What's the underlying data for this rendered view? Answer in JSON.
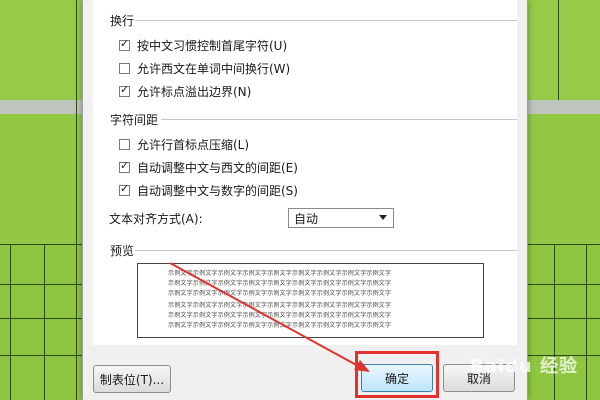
{
  "line_break": {
    "title": "换行",
    "options": [
      {
        "label": "按中文习惯控制首尾字符(U)",
        "checked": true
      },
      {
        "label": "允许西文在单词中间换行(W)",
        "checked": false
      },
      {
        "label": "允许标点溢出边界(N)",
        "checked": true
      }
    ]
  },
  "char_spacing": {
    "title": "字符间距",
    "options": [
      {
        "label": "允许行首标点压缩(L)",
        "checked": false
      },
      {
        "label": "自动调整中文与西文的间距(E)",
        "checked": true
      },
      {
        "label": "自动调整中文与数字的间距(S)",
        "checked": true
      }
    ],
    "align_label": "文本对齐方式(A):",
    "align_value": "自动"
  },
  "preview": {
    "title": "预览",
    "lines": [
      "示例文字示例文字示例文字示例文字示例文字示例文字示例文字示例文字示例文字",
      "示例文字示例文字示例文字示例文字示例文字示例文字示例文字示例文字示例文字",
      "示例文字示例文字示例文字示例文字示例文字示例文字示例文字示例文字示例文字",
      "示例文字示例文字示例文字示例文字示例文字示例文字示例文字示例文字示例文字",
      "示例文字示例文字示例文字示例文字示例文字示例文字示例文字示例文字示例文字",
      "示例文字示例文字示例文字示例文字示例文字示例文字示例文字示例文字示例文字"
    ]
  },
  "buttons": {
    "tabs": "制表位(T)...",
    "ok": "确定",
    "cancel": "取消"
  },
  "watermark": "Baidu 经验",
  "colors": {
    "highlight": "#e0332f",
    "background_green": "#93c844"
  }
}
